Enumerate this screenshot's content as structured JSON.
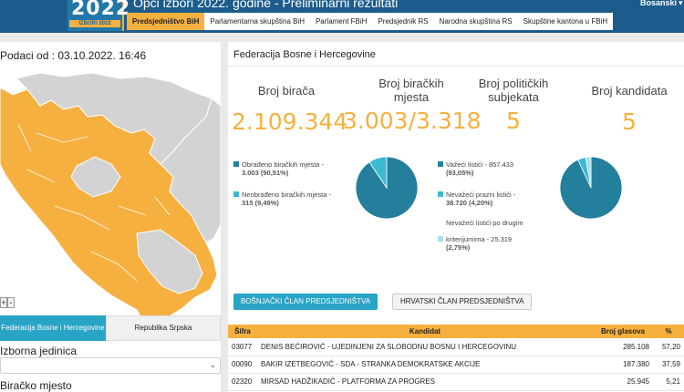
{
  "header": {
    "logo_year": "2022",
    "logo_sub": "IZBORI 2022",
    "title": "Opći izbori 2022. godine - Preliminarni rezultati",
    "language": "Bosanski",
    "nav": [
      {
        "label": "Predsjedništvo BiH",
        "active": true
      },
      {
        "label": "Parlamentarna skupština BiH"
      },
      {
        "label": "Parlament FBiH"
      },
      {
        "label": "Predsjednik RS"
      },
      {
        "label": "Narodna skupština RS"
      },
      {
        "label": "Skupštine kantona u FBiH"
      }
    ]
  },
  "left": {
    "date_line": "Podaci od : 03.10.2022. 16:46",
    "entity_tabs": [
      "Federacija Bosne i Hercegovine",
      "Republika Srpska"
    ],
    "unit_label": "Izborna jedinica",
    "place_label": "Biračko mjesto",
    "colors": {
      "map_active": "#f6b03f",
      "map_inactive": "#d3d3d3"
    }
  },
  "right": {
    "section_title": "Federacija Bosne i Hercegovine",
    "stats": [
      {
        "label": "Broj birača",
        "value": "2.109.344"
      },
      {
        "label": "Broj biračkih mjesta",
        "value": "3.003/3.318"
      },
      {
        "label": "Broj političkih subjekata",
        "value": "5"
      },
      {
        "label": "Broj kandidata",
        "value": "5"
      }
    ],
    "stations_legend": [
      {
        "label": "Obrađeno biračkih mjesta -",
        "value": "3.003 (90,51%)",
        "color": "#237f9c"
      },
      {
        "label": "Neobrađeno biračkih mjesta -",
        "value": "315 (9,49%)",
        "color": "#3cbad1"
      }
    ],
    "ballots_legend": [
      {
        "label": "Važeći listići - 857.433",
        "value": "(93,05%)",
        "color": "#237f9c"
      },
      {
        "label": "Nevažeći prazni listići -",
        "value": "38.720 (4,20%)",
        "color": "#3cbad1"
      },
      {
        "label": "Nevažeći listići po drugim",
        "value": "",
        "color": ""
      },
      {
        "label": "kriterijumima - 25.319",
        "value": "(2,75%)",
        "color": "#a8dfea"
      }
    ],
    "pie_stations": [
      90.51,
      9.49
    ],
    "pie_ballots": [
      93.05,
      4.2,
      2.75
    ],
    "member_buttons": [
      "BOŠNJAČKI ČLAN PREDSJEDNIŠTVA",
      "HRVATSKI ČLAN PREDSJEDNIŠTVA"
    ],
    "table": {
      "headers": [
        "Šifra",
        "Kandidat",
        "Broj glasova",
        "%"
      ],
      "rows": [
        [
          "03077",
          "DENIS BEĆIROVIĆ - UJEDINJENI ZA SLOBODNU BOSNU I HERCEGOVINU",
          "285.108",
          "57,20"
        ],
        [
          "00090",
          "BAKIR IZETBEGOVIĆ - SDA - STRANKA DEMOKRATSKE AKCIJE",
          "187.380",
          "37,59"
        ],
        [
          "02320",
          "MIRSAD HADŽIKADIĆ - PLATFORMA ZA PROGRES",
          "25.945",
          "5,21"
        ]
      ]
    }
  }
}
